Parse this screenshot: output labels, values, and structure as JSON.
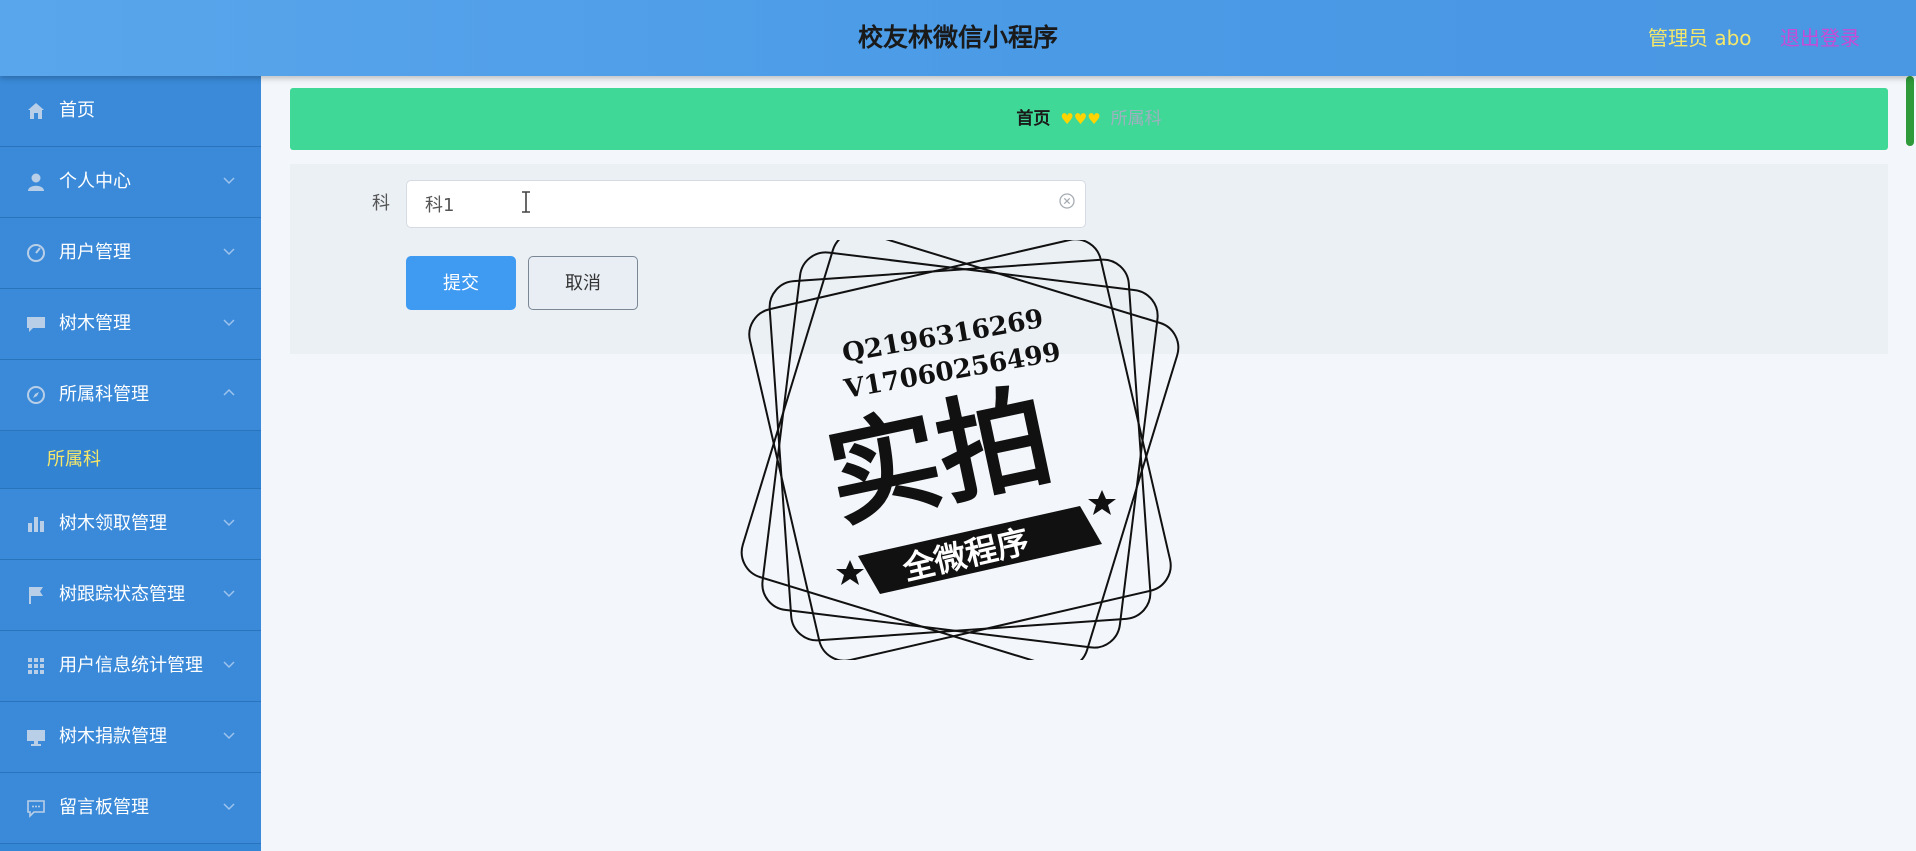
{
  "header": {
    "title": "校友林微信小程序",
    "admin_label": "管理员 abo",
    "logout_label": "退出登录"
  },
  "sidebar": {
    "items": [
      {
        "label": "首页",
        "icon": "home-icon"
      },
      {
        "label": "个人中心",
        "icon": "user-icon"
      },
      {
        "label": "用户管理",
        "icon": "speedometer-icon"
      },
      {
        "label": "树木管理",
        "icon": "chat-icon"
      },
      {
        "label": "所属科管理",
        "icon": "compass-icon",
        "expanded": true
      },
      {
        "label": "树木领取管理",
        "icon": "bar-chart-icon"
      },
      {
        "label": "树跟踪状态管理",
        "icon": "flag-icon"
      },
      {
        "label": "用户信息统计管理",
        "icon": "grid-icon"
      },
      {
        "label": "树木捐款管理",
        "icon": "monitor-icon"
      },
      {
        "label": "留言板管理",
        "icon": "message-icon"
      }
    ],
    "subitem": "所属科"
  },
  "breadcrumb": {
    "home": "首页",
    "separator": "♥♥♥",
    "current": "所属科"
  },
  "form": {
    "field_label": "科",
    "field_value": "科1",
    "submit_label": "提交",
    "cancel_label": "取消"
  },
  "watermark": {
    "line1": "Q2196316269",
    "line2": "V17060256499",
    "big": "实拍",
    "banner": "全微程序"
  },
  "colors": {
    "header_bg": "#4a9ae6",
    "sidebar_bg": "#3a8ad9",
    "breadcrumb_bg": "#3fd896",
    "submit_bg": "#3f9af2",
    "admin_text": "#f4e76a",
    "logout_text": "#c74bd6"
  }
}
